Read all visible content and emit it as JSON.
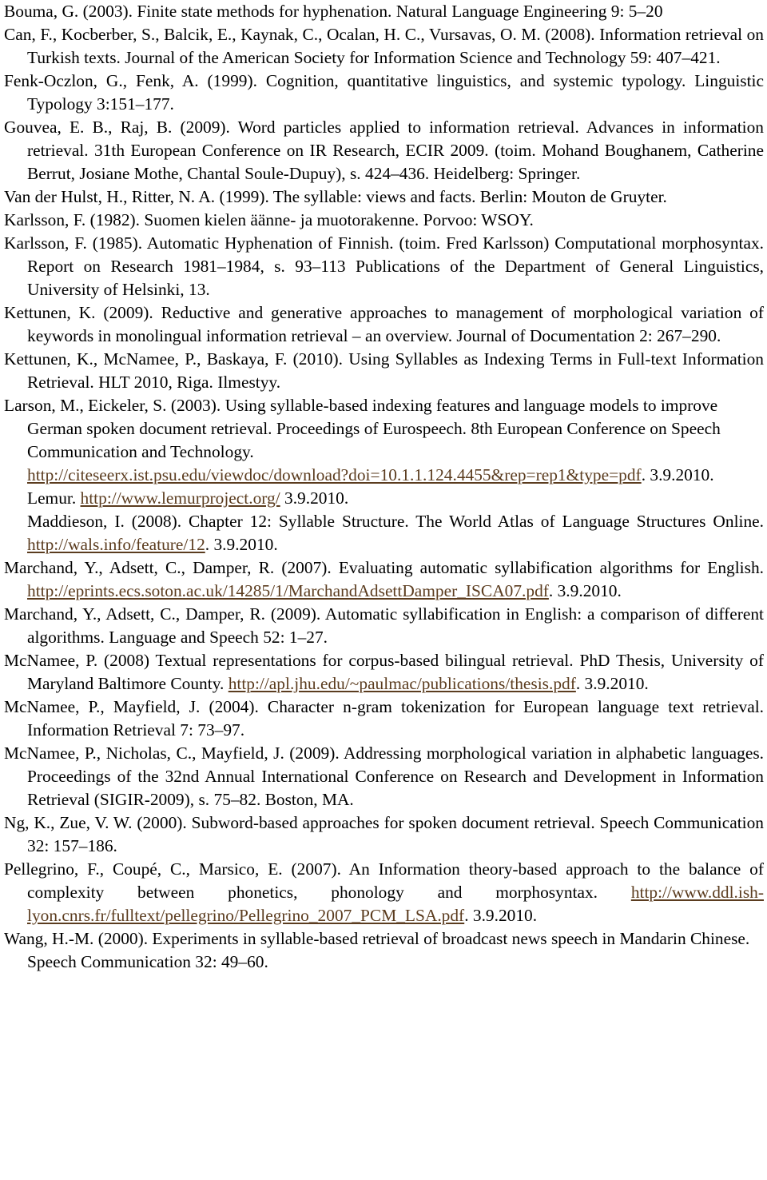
{
  "page": {
    "link_color": "#5b3c1f",
    "text_color": "#000000"
  },
  "references": [
    {
      "text": "Bouma, G. (2003). Finite state methods for hyphenation. Natural Language Engineering 9: 5–20"
    },
    {
      "text": "Can, F., Kocberber, S., Balcik, E., Kaynak, C., Ocalan, H. C., Vursavas, O. M. (2008). Information retrieval on Turkish texts. Journal of the American Society for Information Science and Technology 59: 407–421."
    },
    {
      "text": "Fenk-Oczlon, G., Fenk, A. (1999). Cognition, quantitative linguistics, and systemic typology. Linguistic Typology 3:151–177."
    },
    {
      "text": "Gouvea, E. B., Raj, B. (2009). Word particles applied to information retrieval. Advances in information retrieval. 31th European Conference on IR Research, ECIR 2009. (toim. Mohand Boughanem, Catherine Berrut, Josiane Mothe, Chantal Soule-Dupuy), s. 424–436. Heidelberg: Springer."
    },
    {
      "text": "Van der Hulst, H., Ritter, N. A. (1999). The syllable: views and facts. Berlin: Mouton de Gruyter."
    },
    {
      "text": "Karlsson, F. (1982). Suomen kielen äänne- ja muotorakenne. Porvoo: WSOY."
    },
    {
      "text": "Karlsson, F. (1985). Automatic Hyphenation of Finnish. (toim. Fred Karlsson) Computational morphosyntax. Report on Research 1981–1984, s. 93–113 Publications of the Department of General Linguistics, University of Helsinki, 13."
    },
    {
      "text": "Kettunen, K. (2009). Reductive and generative approaches to management of morphological variation of keywords in monolingual information retrieval – an overview. Journal of Documentation 2: 267–290."
    },
    {
      "text": "Kettunen, K., McNamee, P., Baskaya, F. (2010). Using Syllables as Indexing Terms in Full-text Information Retrieval. HLT 2010, Riga. Ilmestyy."
    },
    {
      "text": "Larson, M., Eickeler, S. (2003). Using syllable-based indexing features and language models to improve German spoken document retrieval. Proceedings of Eurospeech. 8th European Conference on Speech Communication and Technology.",
      "link": "http://citeseerx.ist.psu.edu/viewdoc/download?doi=10.1.1.124.4455&rep=rep1&type=pdf",
      "after": ". 3.9.2010."
    },
    {
      "before": "Lemur. ",
      "link": "http://www.lemurproject.org/",
      "after": " 3.9.2010."
    },
    {
      "text": "Maddieson, I. (2008). Chapter 12: Syllable Structure. The World Atlas of Language Structures Online. ",
      "link": "http://wals.info/feature/12",
      "after": ". 3.9.2010."
    },
    {
      "text": "Marchand, Y., Adsett, C., Damper, R. (2007). Evaluating automatic syllabification algorithms for English. ",
      "link": "http://eprints.ecs.soton.ac.uk/14285/1/MarchandAdsettDamper_ISCA07.pdf",
      "after": ". 3.9.2010."
    },
    {
      "text": "Marchand, Y., Adsett, C., Damper, R. (2009). Automatic syllabification in English: a comparison of different algorithms. Language and Speech 52: 1–27."
    },
    {
      "text": "McNamee, P. (2008) Textual representations for corpus-based bilingual retrieval. PhD Thesis, University of Maryland Baltimore County. ",
      "link": "http://apl.jhu.edu/~paulmac/publications/thesis.pdf",
      "after": ". 3.9.2010."
    },
    {
      "text": "McNamee, P., Mayfield, J. (2004). Character n-gram tokenization for European language text retrieval. Information Retrieval 7: 73–97."
    },
    {
      "text": "McNamee, P., Nicholas, C., Mayfield, J. (2009). Addressing morphological variation in alphabetic languages. Proceedings of the 32nd Annual International Conference on Research and Development in Information Retrieval (SIGIR-2009), s. 75–82. Boston, MA."
    },
    {
      "text": "Ng, K., Zue, V. W. (2000). Subword-based approaches for spoken document retrieval. Speech Communication 32: 157–186."
    },
    {
      "text": "Pellegrino, F., Coupé, C., Marsico, E. (2007). An Information theory-based approach to the balance of complexity between phonetics, phonology and morphosyntax. ",
      "link": "http://www.ddl.ish-lyon.cnrs.fr/fulltext/pellegrino/Pellegrino_2007_PCM_LSA.pdf",
      "after": ". 3.9.2010."
    },
    {
      "text": "Wang, H.-M. (2000). Experiments in syllable-based retrieval of broadcast news speech in Mandarin Chinese. Speech Communication 32: 49–60."
    }
  ]
}
